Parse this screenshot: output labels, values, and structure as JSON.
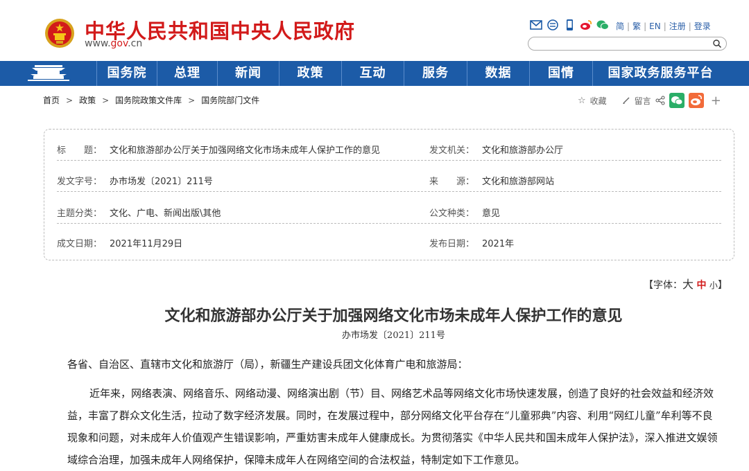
{
  "header": {
    "site_name": "中华人民共和国中央人民政府",
    "site_url_prefix": "www.",
    "site_url_domain": "gov",
    "site_url_suffix": ".cn",
    "lang_links": [
      "简",
      "繁",
      "EN",
      "注册",
      "登录"
    ],
    "icons": [
      "mail-icon",
      "message-icon",
      "mobile-icon",
      "weibo-icon",
      "wechat-icon"
    ]
  },
  "nav": {
    "items": [
      "国务院",
      "总理",
      "新闻",
      "政策",
      "互动",
      "服务",
      "数据",
      "国情",
      "国家政务服务平台"
    ]
  },
  "breadcrumb": [
    "首页",
    "政策",
    "国务院政策文件库",
    "国务院部门文件"
  ],
  "tools": {
    "favorite": "收藏",
    "comment": "留言"
  },
  "meta": {
    "title_label": "标　　题：",
    "title_value": "文化和旅游部办公厅关于加强网络文化市场未成年人保护工作的意见",
    "issuer_label": "发文机关：",
    "issuer_value": "文化和旅游部办公厅",
    "docno_label": "发文字号：",
    "docno_value": "办市场发〔2021〕211号",
    "source_label": "来　　源：",
    "source_value": "文化和旅游部网站",
    "topic_label": "主题分类：",
    "topic_value": "文化、广电、新闻出版\\其他",
    "type_label": "公文种类：",
    "type_value": "意见",
    "written_label": "成文日期：",
    "written_value": "2021年11月29日",
    "published_label": "发布日期：",
    "published_value": "2021年"
  },
  "font_size": {
    "open": "【字体：",
    "large": "大",
    "medium": "中",
    "small": "小",
    "close": "】"
  },
  "document": {
    "title": "文化和旅游部办公厅关于加强网络文化市场未成年人保护工作的意见",
    "number": "办市场发〔2021〕211号",
    "salutation": "各省、自治区、直辖市文化和旅游厅（局），新疆生产建设兵团文化体育广电和旅游局：",
    "paragraph_1": "近年来，网络表演、网络音乐、网络动漫、网络演出剧（节）目、网络艺术品等网络文化市场快速发展，创造了良好的社会效益和经济效益，丰富了群众文化生活，拉动了数字经济发展。同时，在发展过程中，部分网络文化平台存在“儿童邪典”内容、利用“网红儿童”牟利等不良现象和问题，对未成年人价值观产生错误影响，严重妨害未成年人健康成长。为贯彻落实《中华人民共和国未成年人保护法》，深入推进文娱领域综合治理，加强未成年人网络保护，保障未成年人在网络空间的合法权益，特制定如下工作意见。"
  },
  "colors": {
    "brand_red": "#d21a1a",
    "nav_blue": "#1c5ba7",
    "link_blue": "#2a5fa8"
  }
}
